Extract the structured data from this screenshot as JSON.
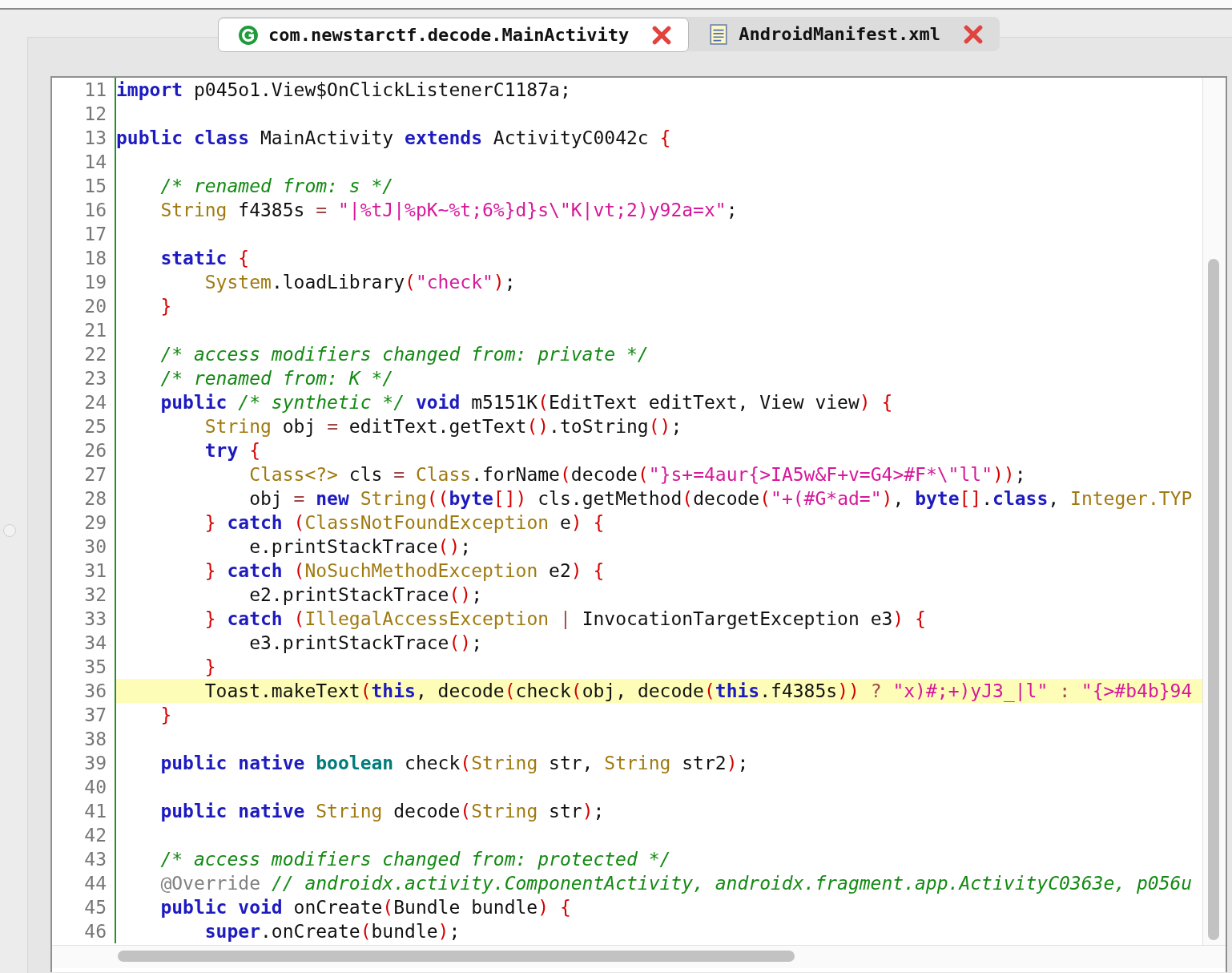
{
  "tabs": [
    {
      "label": "com.newstarctf.decode.MainActivity",
      "selected": true,
      "kind": "class"
    },
    {
      "label": "AndroidManifest.xml",
      "selected": false,
      "kind": "file"
    }
  ],
  "editor": {
    "lines": [
      {
        "number": "11",
        "highlighted": false,
        "tokens": [
          {
            "kind": "keyword",
            "text": "import"
          },
          {
            "kind": "plain",
            "text": " p045o1.View$OnClickListenerC1187a;"
          }
        ]
      },
      {
        "number": "12",
        "highlighted": false
      },
      {
        "number": "13",
        "highlighted": false,
        "tokens": [
          {
            "kind": "keyword",
            "text": "public class"
          },
          {
            "kind": "plain",
            "text": " MainActivity "
          },
          {
            "kind": "keyword",
            "text": "extends"
          },
          {
            "kind": "plain",
            "text": " ActivityC0042c "
          },
          {
            "kind": "paren",
            "text": "{"
          }
        ]
      },
      {
        "number": "14",
        "highlighted": false
      },
      {
        "number": "15",
        "highlighted": false,
        "tokens": [
          {
            "kind": "comment",
            "text": "    /* renamed from: s */"
          }
        ]
      },
      {
        "number": "16",
        "highlighted": false,
        "tokens": [
          {
            "kind": "type",
            "text": "    String"
          },
          {
            "kind": "plain",
            "text": " f4385s "
          },
          {
            "kind": "op",
            "text": "= "
          },
          {
            "kind": "string",
            "text": "\"|%tJ|%pK~%t;6%}d}s\\\"K|vt;2)y92a=x\""
          },
          {
            "kind": "plain",
            "text": ";"
          }
        ]
      },
      {
        "number": "17",
        "highlighted": false
      },
      {
        "number": "18",
        "highlighted": false,
        "tokens": [
          {
            "kind": "keyword",
            "text": "    static "
          },
          {
            "kind": "paren",
            "text": "{"
          }
        ]
      },
      {
        "number": "19",
        "highlighted": false,
        "tokens": [
          {
            "kind": "type",
            "text": "        System"
          },
          {
            "kind": "plain",
            "text": ".loadLibrary"
          },
          {
            "kind": "paren",
            "text": "("
          },
          {
            "kind": "string",
            "text": "\"check\""
          },
          {
            "kind": "paren",
            "text": ")"
          },
          {
            "kind": "plain",
            "text": ";"
          }
        ]
      },
      {
        "number": "20",
        "highlighted": false,
        "tokens": [
          {
            "kind": "paren",
            "text": "    }"
          }
        ]
      },
      {
        "number": "21",
        "highlighted": false
      },
      {
        "number": "22",
        "highlighted": false,
        "tokens": [
          {
            "kind": "comment",
            "text": "    /* access modifiers changed from: private */"
          }
        ]
      },
      {
        "number": "23",
        "highlighted": false,
        "tokens": [
          {
            "kind": "comment",
            "text": "    /* renamed from: K */"
          }
        ]
      },
      {
        "number": "24",
        "highlighted": false,
        "tokens": [
          {
            "kind": "keyword",
            "text": "    public "
          },
          {
            "kind": "comment",
            "text": "/* synthetic */ "
          },
          {
            "kind": "keyword",
            "text": "void"
          },
          {
            "kind": "plain",
            "text": " m5151K"
          },
          {
            "kind": "paren",
            "text": "("
          },
          {
            "kind": "plain",
            "text": "EditText editText, View view"
          },
          {
            "kind": "paren",
            "text": ") {"
          }
        ]
      },
      {
        "number": "25",
        "highlighted": false,
        "tokens": [
          {
            "kind": "type",
            "text": "        String"
          },
          {
            "kind": "plain",
            "text": " obj "
          },
          {
            "kind": "op",
            "text": "="
          },
          {
            "kind": "plain",
            "text": " editText.getText"
          },
          {
            "kind": "paren",
            "text": "()"
          },
          {
            "kind": "plain",
            "text": ".toString"
          },
          {
            "kind": "paren",
            "text": "()"
          },
          {
            "kind": "plain",
            "text": ";"
          }
        ]
      },
      {
        "number": "26",
        "highlighted": false,
        "tokens": [
          {
            "kind": "keyword",
            "text": "        try "
          },
          {
            "kind": "paren",
            "text": "{"
          }
        ]
      },
      {
        "number": "27",
        "highlighted": false,
        "tokens": [
          {
            "kind": "type",
            "text": "            Class<?>"
          },
          {
            "kind": "plain",
            "text": " cls "
          },
          {
            "kind": "op",
            "text": "= "
          },
          {
            "kind": "type",
            "text": "Class"
          },
          {
            "kind": "plain",
            "text": ".forName"
          },
          {
            "kind": "paren",
            "text": "("
          },
          {
            "kind": "plain",
            "text": "decode"
          },
          {
            "kind": "paren",
            "text": "("
          },
          {
            "kind": "string",
            "text": "\"}s+=4aur{>IA5w&F+v=G4>#F*\\\"ll\""
          },
          {
            "kind": "paren",
            "text": "))"
          },
          {
            "kind": "plain",
            "text": ";"
          }
        ]
      },
      {
        "number": "28",
        "highlighted": false,
        "tokens": [
          {
            "kind": "plain",
            "text": "            obj "
          },
          {
            "kind": "op",
            "text": "= "
          },
          {
            "kind": "keyword",
            "text": "new "
          },
          {
            "kind": "type",
            "text": "String"
          },
          {
            "kind": "paren",
            "text": "(("
          },
          {
            "kind": "keyword",
            "text": "byte"
          },
          {
            "kind": "paren",
            "text": "[])"
          },
          {
            "kind": "plain",
            "text": " cls.getMethod"
          },
          {
            "kind": "paren",
            "text": "("
          },
          {
            "kind": "plain",
            "text": "decode"
          },
          {
            "kind": "paren",
            "text": "("
          },
          {
            "kind": "string",
            "text": "\"+(#G*ad=\""
          },
          {
            "kind": "paren",
            "text": ")"
          },
          {
            "kind": "plain",
            "text": ", "
          },
          {
            "kind": "keyword",
            "text": "byte"
          },
          {
            "kind": "paren",
            "text": "[]"
          },
          {
            "kind": "plain",
            "text": "."
          },
          {
            "kind": "keyword",
            "text": "class"
          },
          {
            "kind": "plain",
            "text": ", "
          },
          {
            "kind": "type",
            "text": "Integer.TYP"
          }
        ]
      },
      {
        "number": "29",
        "highlighted": false,
        "tokens": [
          {
            "kind": "paren",
            "text": "        } "
          },
          {
            "kind": "keyword",
            "text": "catch "
          },
          {
            "kind": "paren",
            "text": "("
          },
          {
            "kind": "type",
            "text": "ClassNotFoundException"
          },
          {
            "kind": "plain",
            "text": " e"
          },
          {
            "kind": "paren",
            "text": ") {"
          }
        ]
      },
      {
        "number": "30",
        "highlighted": false,
        "tokens": [
          {
            "kind": "plain",
            "text": "            e.printStackTrace"
          },
          {
            "kind": "paren",
            "text": "()"
          },
          {
            "kind": "plain",
            "text": ";"
          }
        ]
      },
      {
        "number": "31",
        "highlighted": false,
        "tokens": [
          {
            "kind": "paren",
            "text": "        } "
          },
          {
            "kind": "keyword",
            "text": "catch "
          },
          {
            "kind": "paren",
            "text": "("
          },
          {
            "kind": "type",
            "text": "NoSuchMethodException"
          },
          {
            "kind": "plain",
            "text": " e2"
          },
          {
            "kind": "paren",
            "text": ") {"
          }
        ]
      },
      {
        "number": "32",
        "highlighted": false,
        "tokens": [
          {
            "kind": "plain",
            "text": "            e2.printStackTrace"
          },
          {
            "kind": "paren",
            "text": "()"
          },
          {
            "kind": "plain",
            "text": ";"
          }
        ]
      },
      {
        "number": "33",
        "highlighted": false,
        "tokens": [
          {
            "kind": "paren",
            "text": "        } "
          },
          {
            "kind": "keyword",
            "text": "catch "
          },
          {
            "kind": "paren",
            "text": "("
          },
          {
            "kind": "type",
            "text": "IllegalAccessException"
          },
          {
            "kind": "op",
            "text": " | "
          },
          {
            "kind": "plain",
            "text": "InvocationTargetException e3"
          },
          {
            "kind": "paren",
            "text": ") {"
          }
        ]
      },
      {
        "number": "34",
        "highlighted": false,
        "tokens": [
          {
            "kind": "plain",
            "text": "            e3.printStackTrace"
          },
          {
            "kind": "paren",
            "text": "()"
          },
          {
            "kind": "plain",
            "text": ";"
          }
        ]
      },
      {
        "number": "35",
        "highlighted": false,
        "tokens": [
          {
            "kind": "paren",
            "text": "        }"
          }
        ]
      },
      {
        "number": "36",
        "highlighted": true,
        "tokens": [
          {
            "kind": "plain",
            "text": "        Toast.makeText"
          },
          {
            "kind": "paren",
            "text": "("
          },
          {
            "kind": "keyword",
            "text": "this"
          },
          {
            "kind": "plain",
            "text": ", decode"
          },
          {
            "kind": "paren",
            "text": "("
          },
          {
            "kind": "plain",
            "text": "check"
          },
          {
            "kind": "paren",
            "text": "("
          },
          {
            "kind": "plain",
            "text": "obj, decode"
          },
          {
            "kind": "paren",
            "text": "("
          },
          {
            "kind": "keyword",
            "text": "this"
          },
          {
            "kind": "plain",
            "text": ".f4385s"
          },
          {
            "kind": "paren",
            "text": "))"
          },
          {
            "kind": "op",
            "text": " ? "
          },
          {
            "kind": "string",
            "text": "\"x)#;+)yJ3_|l\""
          },
          {
            "kind": "op",
            "text": " : "
          },
          {
            "kind": "string",
            "text": "\"{>#b4b}94"
          }
        ]
      },
      {
        "number": "37",
        "highlighted": false,
        "tokens": [
          {
            "kind": "paren",
            "text": "    }"
          }
        ]
      },
      {
        "number": "38",
        "highlighted": false
      },
      {
        "number": "39",
        "highlighted": false,
        "tokens": [
          {
            "kind": "keyword",
            "text": "    public native "
          },
          {
            "kind": "primitive",
            "text": "boolean"
          },
          {
            "kind": "plain",
            "text": " check"
          },
          {
            "kind": "paren",
            "text": "("
          },
          {
            "kind": "type",
            "text": "String"
          },
          {
            "kind": "plain",
            "text": " str, "
          },
          {
            "kind": "type",
            "text": "String"
          },
          {
            "kind": "plain",
            "text": " str2"
          },
          {
            "kind": "paren",
            "text": ")"
          },
          {
            "kind": "plain",
            "text": ";"
          }
        ]
      },
      {
        "number": "40",
        "highlighted": false
      },
      {
        "number": "41",
        "highlighted": false,
        "tokens": [
          {
            "kind": "keyword",
            "text": "    public native "
          },
          {
            "kind": "type",
            "text": "String"
          },
          {
            "kind": "plain",
            "text": " decode"
          },
          {
            "kind": "paren",
            "text": "("
          },
          {
            "kind": "type",
            "text": "String"
          },
          {
            "kind": "plain",
            "text": " str"
          },
          {
            "kind": "paren",
            "text": ")"
          },
          {
            "kind": "plain",
            "text": ";"
          }
        ]
      },
      {
        "number": "42",
        "highlighted": false
      },
      {
        "number": "43",
        "highlighted": false,
        "tokens": [
          {
            "kind": "comment",
            "text": "    /* access modifiers changed from: protected */"
          }
        ]
      },
      {
        "number": "44",
        "highlighted": false,
        "tokens": [
          {
            "kind": "annotation",
            "text": "    @Override "
          },
          {
            "kind": "comment",
            "text": "// androidx.activity.ComponentActivity, androidx.fragment.app.ActivityC0363e, p056u"
          }
        ]
      },
      {
        "number": "45",
        "highlighted": false,
        "tokens": [
          {
            "kind": "keyword",
            "text": "    public void"
          },
          {
            "kind": "plain",
            "text": " onCreate"
          },
          {
            "kind": "paren",
            "text": "("
          },
          {
            "kind": "plain",
            "text": "Bundle bundle"
          },
          {
            "kind": "paren",
            "text": ") {"
          }
        ]
      },
      {
        "number": "46",
        "highlighted": false,
        "tokens": [
          {
            "kind": "keyword",
            "text": "        super"
          },
          {
            "kind": "plain",
            "text": ".onCreate"
          },
          {
            "kind": "paren",
            "text": "("
          },
          {
            "kind": "plain",
            "text": "bundle"
          },
          {
            "kind": "paren",
            "text": ")"
          },
          {
            "kind": "plain",
            "text": ";"
          }
        ]
      }
    ]
  }
}
